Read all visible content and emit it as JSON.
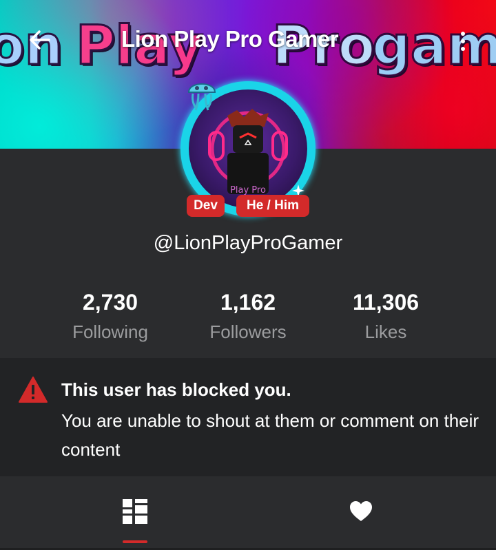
{
  "header": {
    "title": "Lion Play Pro Gamer",
    "back_icon": "arrow-left-icon",
    "menu_icon": "more-vertical-icon",
    "banner_text": [
      "on",
      "Play",
      "Pro",
      "game"
    ]
  },
  "profile": {
    "badges": [
      "Dev",
      "He / Him"
    ],
    "handle": "@LionPlayProGamer",
    "avatar_text": "Play Pro"
  },
  "stats": [
    {
      "value": "2,730",
      "label": "Following"
    },
    {
      "value": "1,162",
      "label": "Followers"
    },
    {
      "value": "11,306",
      "label": "Likes"
    }
  ],
  "notice": {
    "icon": "warning-triangle-icon",
    "title": "This user has blocked you.",
    "body": "You are unable to shout at them or comment on their content"
  },
  "tabs": [
    {
      "icon": "grid-layout-icon",
      "active": true
    },
    {
      "icon": "heart-icon",
      "active": false
    }
  ],
  "colors": {
    "accent": "#d32a2a",
    "background": "#2b2c2e",
    "notice_bg": "#222325",
    "muted_text": "#9b9c9e"
  }
}
